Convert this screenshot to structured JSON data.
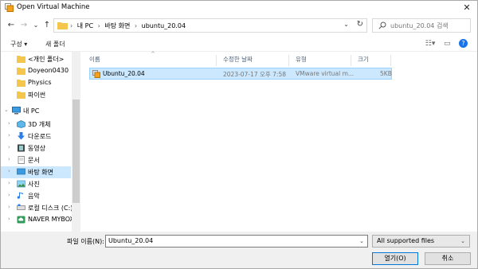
{
  "window": {
    "title": "Open Virtual Machine",
    "close": "✕"
  },
  "nav": {
    "back": "←",
    "forward": "→",
    "recent": "⌄",
    "up": "↑",
    "breadcrumbs": [
      "내 PC",
      "바탕 화면",
      "ubuntu_20.04"
    ],
    "search_placeholder": "ubuntu_20.04 검색"
  },
  "toolbar": {
    "organize": "구성 ▾",
    "new_folder": "새 폴더"
  },
  "sidebar": {
    "items": [
      {
        "label": "<개인 폴더>",
        "icon": "folder-icon"
      },
      {
        "label": "Doyeon0430",
        "icon": "folder-icon"
      },
      {
        "label": "Physics",
        "icon": "folder-icon"
      },
      {
        "label": "파이썬",
        "icon": "folder-icon"
      },
      {
        "label": "내 PC",
        "icon": "computer-icon"
      },
      {
        "label": "3D 개체",
        "icon": "cube-icon"
      },
      {
        "label": "다운로드",
        "icon": "download-icon"
      },
      {
        "label": "동영상",
        "icon": "film-icon"
      },
      {
        "label": "문서",
        "icon": "document-icon"
      },
      {
        "label": "바탕 화면",
        "icon": "desktop-icon"
      },
      {
        "label": "사진",
        "icon": "pictures-icon"
      },
      {
        "label": "음악",
        "icon": "music-icon"
      },
      {
        "label": "로컬 디스크 (C:)",
        "icon": "drive-icon"
      },
      {
        "label": "NAVER MYBOX",
        "icon": "cloud-icon"
      }
    ]
  },
  "files": {
    "columns": [
      "이름",
      "수정한 날짜",
      "유형",
      "크기"
    ],
    "rows": [
      {
        "name": "Ubuntu_20.04",
        "date": "2023-07-17 오후 7:58",
        "type": "VMware virtual m...",
        "size": "5KB"
      }
    ]
  },
  "footer": {
    "filename_label": "파일 이름(N):",
    "filename_value": "Ubuntu_20.04",
    "filter_value": "All supported files",
    "open_button": "열기(O)",
    "cancel_button": "취소"
  },
  "colors": {
    "selection": "#cce8ff",
    "accent": "#0078d7",
    "folder": "#f4c64b"
  }
}
